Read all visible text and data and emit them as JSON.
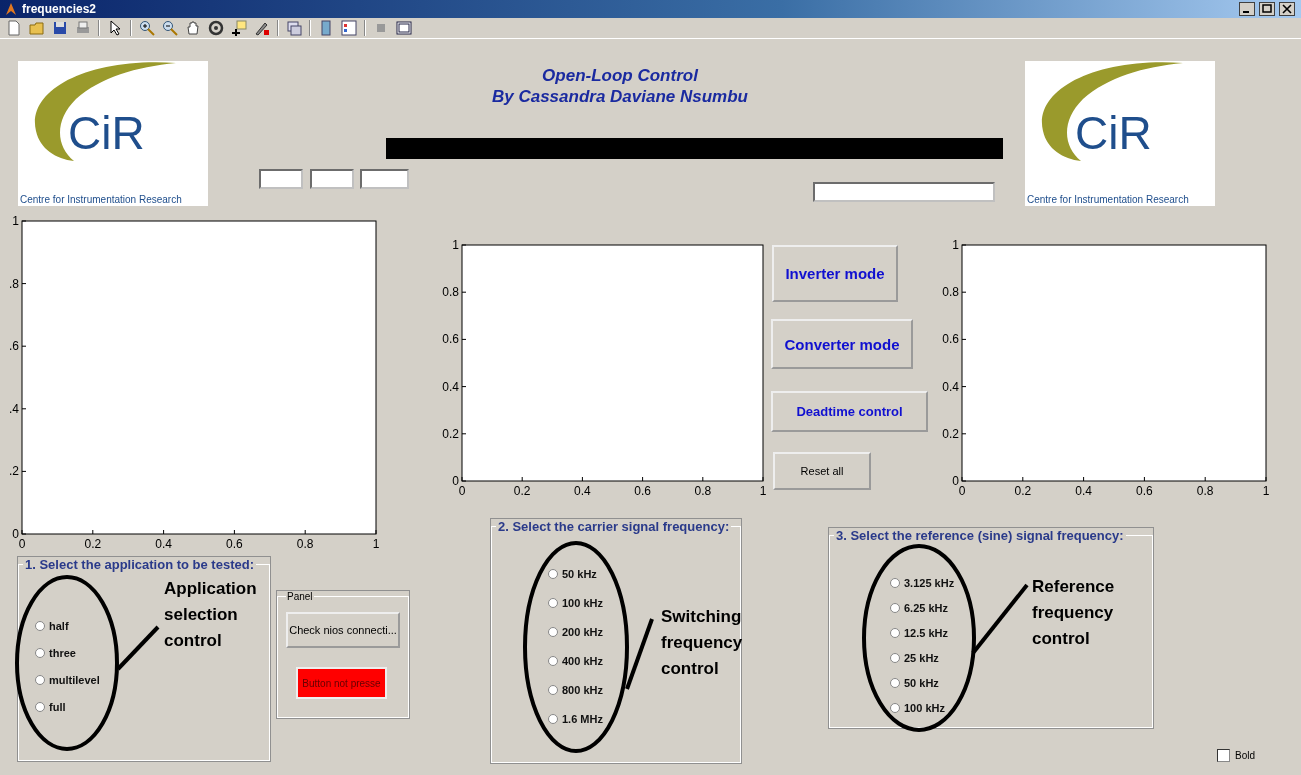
{
  "window": {
    "title": "frequencies2"
  },
  "logos": [
    {
      "mark": "CiR",
      "caption": "Centre for Instrumentation Research"
    },
    {
      "mark": "CiR",
      "caption": "Centre for Instrumentation Research"
    }
  ],
  "heading": [
    "Open-Loop Control",
    "By Cassandra Daviane Nsumbu"
  ],
  "progress": {
    "level": 1
  },
  "edit_boxes": [
    {
      "kind": "edit"
    },
    {
      "kind": "edit"
    },
    {
      "kind": "edit"
    },
    {
      "kind": "edit"
    }
  ],
  "axes": [
    {
      "chart_data": {
        "type": "line",
        "xlim": [
          0,
          1
        ],
        "ylim": [
          0,
          1
        ],
        "xticks": [
          0,
          0.2,
          0.4,
          0.6,
          0.8,
          1
        ],
        "yticks": [
          0,
          {
            "value": 0.2,
            "label": ".2"
          },
          {
            "value": 0.4,
            "label": ".4"
          },
          {
            "value": 0.6,
            "label": ".6"
          },
          {
            "value": 0.8,
            "label": ".8"
          },
          1
        ]
      }
    },
    {
      "chart_data": {
        "type": "line",
        "xlim": [
          0,
          1
        ],
        "ylim": [
          0,
          1
        ],
        "xticks": [
          0,
          0.2,
          0.4,
          0.6,
          0.8,
          1
        ],
        "yticks": [
          0,
          0.2,
          0.4,
          0.6,
          0.8,
          1
        ]
      }
    },
    {
      "chart_data": {
        "type": "line",
        "xlim": [
          0,
          1
        ],
        "ylim": [
          0,
          1
        ],
        "xticks": [
          0,
          0.2,
          0.4,
          0.6,
          0.8,
          1
        ],
        "yticks": [
          0,
          0.2,
          0.4,
          0.6,
          0.8,
          1
        ]
      }
    }
  ],
  "mode_buttons": [
    {
      "label": "Inverter mode",
      "kind": "large"
    },
    {
      "label": "Converter mode",
      "kind": "large"
    },
    {
      "label": "Deadtime control",
      "kind": "medium"
    },
    {
      "label": "Reset all",
      "kind": "small"
    }
  ],
  "groups": [
    {
      "title": "1. Select the application to be tested:",
      "options": [
        {
          "label": "half",
          "selected": false
        },
        {
          "label": "three",
          "selected": false
        },
        {
          "label": "multilevel",
          "selected": false
        },
        {
          "label": "full",
          "selected": false
        }
      ],
      "note": [
        "Application",
        "selection",
        "control"
      ]
    },
    {
      "title": "2. Select the carrier signal frequency:",
      "options": [
        {
          "label": "50 kHz",
          "selected": false
        },
        {
          "label": "100 kHz",
          "selected": false
        },
        {
          "label": "200 kHz",
          "selected": false
        },
        {
          "label": "400 kHz",
          "selected": false
        },
        {
          "label": "800 kHz",
          "selected": false
        },
        {
          "label": "1.6 MHz",
          "selected": false
        }
      ],
      "note": [
        "Switching",
        "frequency",
        "control"
      ]
    },
    {
      "title": "3. Select the reference (sine) signal frequency:",
      "options": [
        {
          "label": "3.125 kHz",
          "selected": false
        },
        {
          "label": "6.25 kHz",
          "selected": false
        },
        {
          "label": "12.5 kHz",
          "selected": false
        },
        {
          "label": "25 kHz",
          "selected": false
        },
        {
          "label": "50 kHz",
          "selected": false
        },
        {
          "label": "100 kHz",
          "selected": false
        }
      ],
      "note": [
        "Reference",
        "frequency",
        "control"
      ]
    }
  ],
  "panel": {
    "title": "Panel",
    "check_button": "Check nios connecti...",
    "status_button": "Button not presse"
  },
  "bold_checkbox": {
    "label": "Bold",
    "checked": false
  }
}
